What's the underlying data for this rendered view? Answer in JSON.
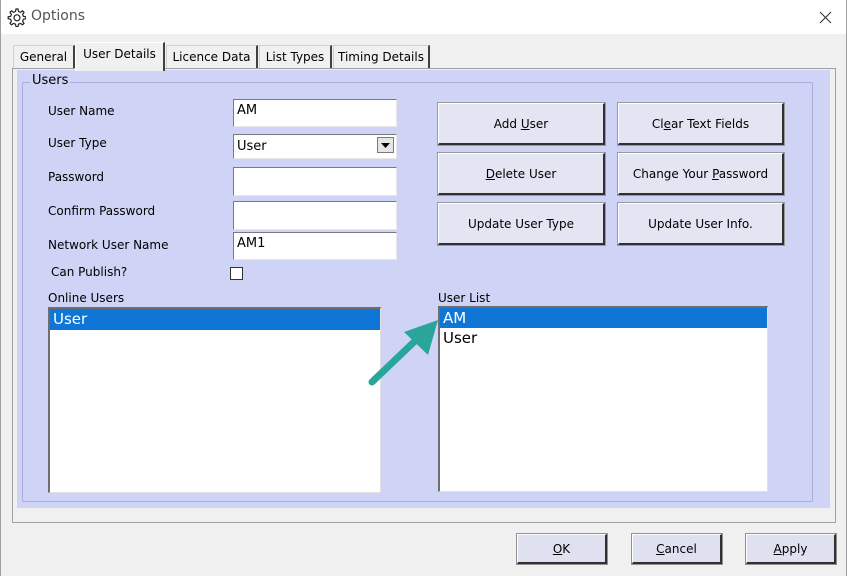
{
  "window": {
    "title": "Options",
    "icon": "gear-puzzle-icon"
  },
  "tabs": [
    {
      "label": "General",
      "active": false
    },
    {
      "label": "User Details",
      "active": true
    },
    {
      "label": "Licence Data",
      "active": false
    },
    {
      "label": "List Types",
      "active": false
    },
    {
      "label": "Timing Details",
      "active": false
    }
  ],
  "users_group": {
    "title": "Users",
    "user_name_label": "User Name",
    "user_name_value": "AM",
    "user_type_label": "User Type",
    "user_type_value": "User",
    "password_label": "Password",
    "password_value": "",
    "confirm_password_label": "Confirm Password",
    "confirm_password_value": "",
    "network_user_name_label": "Network User Name",
    "network_user_name_value": "AM1",
    "can_publish_label": "Can Publish?",
    "can_publish_checked": false
  },
  "buttons": {
    "add_user": {
      "pre": "Add ",
      "u": "U",
      "post": "ser"
    },
    "clear_text_fields": {
      "pre": "Cl",
      "u": "e",
      "post": "ar Text Fields"
    },
    "delete_user": {
      "pre": "",
      "u": "D",
      "post": "elete User"
    },
    "change_password": {
      "pre": "Change Your ",
      "u": "P",
      "post": "assword"
    },
    "update_user_type": "Update User Type",
    "update_user_info": "Update User Info."
  },
  "online_users": {
    "label": "Online Users",
    "items": [
      {
        "text": "User",
        "selected": true
      }
    ]
  },
  "user_list": {
    "label": "User List",
    "items": [
      {
        "text": "AM",
        "selected": true
      },
      {
        "text": "User",
        "selected": false
      }
    ]
  },
  "footer": {
    "ok": {
      "pre": "",
      "u": "O",
      "post": "K"
    },
    "cancel": {
      "pre": "",
      "u": "C",
      "post": "ancel"
    },
    "apply": {
      "pre": "",
      "u": "A",
      "post": "pply"
    }
  },
  "colors": {
    "panel_bg": "#cfd4f6",
    "selection": "#0f76d7",
    "arrow_annotation": "#2aa59a"
  }
}
